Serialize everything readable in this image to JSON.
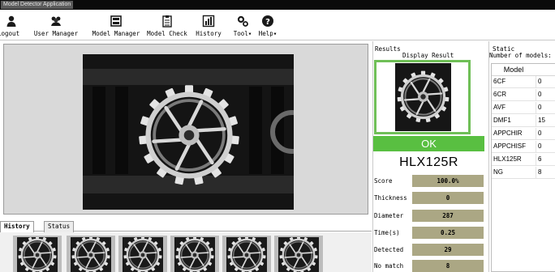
{
  "window": {
    "title": "Model Detector Application"
  },
  "toolbar": {
    "items": [
      {
        "label": "Logout",
        "icon": "user-icon"
      },
      {
        "label": "User Manager",
        "icon": "users-icon"
      },
      {
        "label": "Model Manager",
        "icon": "model-manager-icon"
      },
      {
        "label": "Model Check",
        "icon": "clipboard-icon"
      },
      {
        "label": "History",
        "icon": "history-chart-icon"
      },
      {
        "label": "Tool",
        "icon": "tools-gear-icon"
      },
      {
        "label": "Help",
        "icon": "help-icon"
      }
    ]
  },
  "history": {
    "tabs": [
      "History",
      "Status"
    ]
  },
  "results": {
    "section_title": "Results",
    "display_title": "Display Result",
    "status": "OK",
    "status_color": "#59bf41",
    "model": "HLX125R",
    "metrics": [
      {
        "label": "Score",
        "value": "100.0%"
      },
      {
        "label": "Thickness",
        "value": "0"
      },
      {
        "label": "Diameter",
        "value": "287"
      },
      {
        "label": "Time(s)",
        "value": "0.25"
      },
      {
        "label": "Detected",
        "value": "29"
      },
      {
        "label": "No match",
        "value": "8"
      }
    ]
  },
  "static": {
    "section_title": "Static",
    "count_label": "Number of models:",
    "column_header": "Model",
    "rows": [
      {
        "model": "6CF",
        "count": "0"
      },
      {
        "model": "6CR",
        "count": "0"
      },
      {
        "model": "AVF",
        "count": "0"
      },
      {
        "model": "DMF1",
        "count": "15"
      },
      {
        "model": "APPCHIR",
        "count": "0"
      },
      {
        "model": "APPCHISF",
        "count": "0"
      },
      {
        "model": "HLX125R",
        "count": "6"
      },
      {
        "model": "NG",
        "count": "8"
      }
    ]
  }
}
